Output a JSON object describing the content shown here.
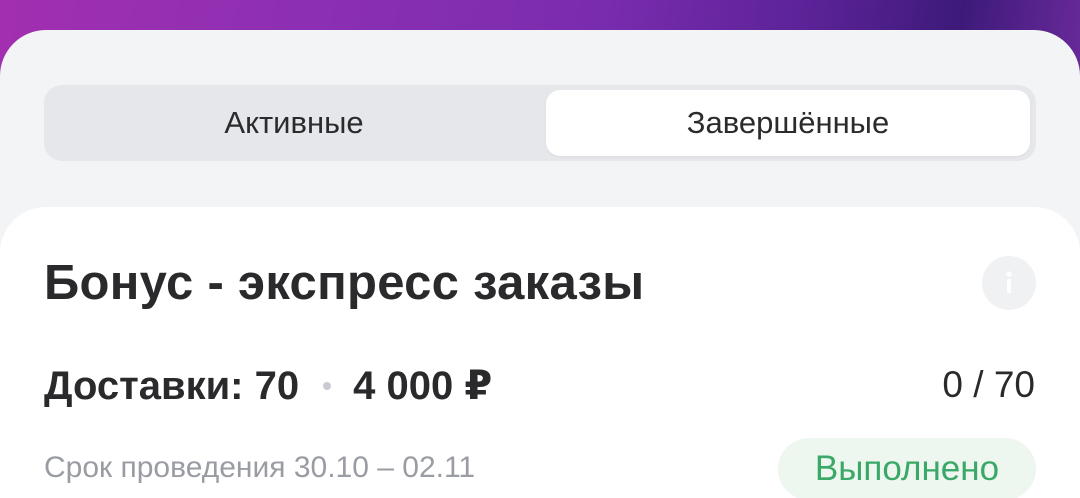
{
  "tabs": {
    "active_label": "Активные",
    "completed_label": "Завершённые",
    "selected": "completed"
  },
  "bonus_card": {
    "title": "Бонус - экспресс заказы",
    "deliveries_text": "Доставки: 70",
    "amount_text": "4 000 ₽",
    "progress": {
      "current": 0,
      "target": 70,
      "text": "0 / 70"
    },
    "period_text": "Срок проведения 30.10 – 02.11",
    "status_text": "Выполнено",
    "info_icon": "info-icon"
  },
  "colors": {
    "status_green": "#3aa866",
    "status_bg": "#eef6f0",
    "banner_purple": "#8b2fb3"
  }
}
